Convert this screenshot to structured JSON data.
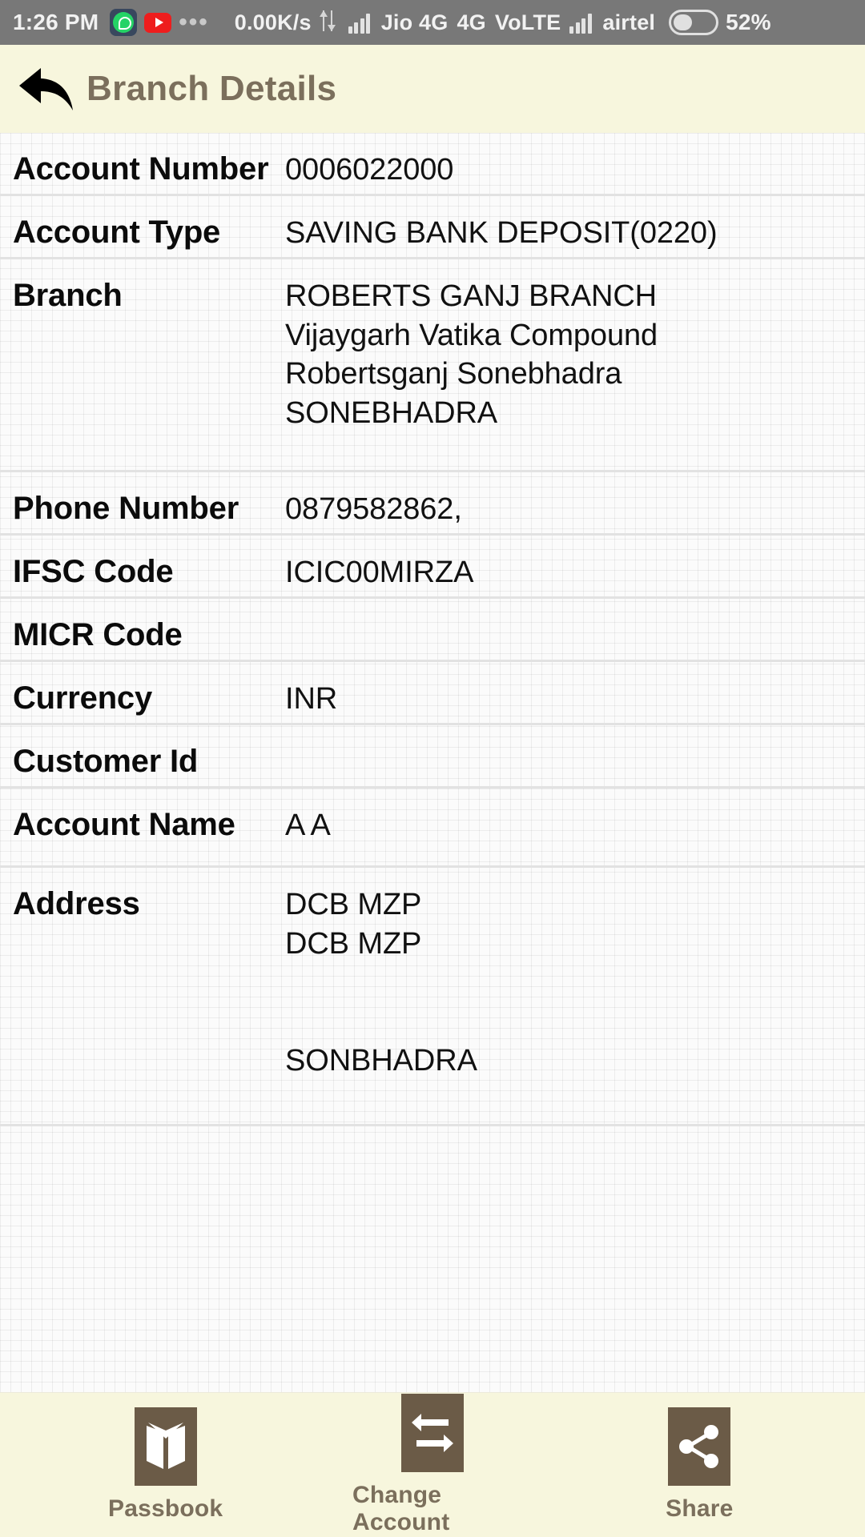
{
  "status_bar": {
    "time": "1:26 PM",
    "icons": [
      "whatsapp-icon",
      "youtube-icon",
      "more-dots-icon"
    ],
    "network_speed": "0.00K/s",
    "data_transfer_icon": "up-down-arrows-icon",
    "sim1_signal_icon": "signal-bars-icon",
    "sim1_carrier": "Jio 4G",
    "network_type": "4G",
    "volte": "VoLTE",
    "sim2_signal_icon": "signal-bars-icon",
    "sim2_carrier": "airtel",
    "battery_icon": "battery-icon",
    "battery_percent": "52%"
  },
  "header": {
    "back_icon": "back-arrow-icon",
    "title": "Branch Details"
  },
  "details": {
    "rows": [
      {
        "label": "Account Number",
        "value": "0006022000"
      },
      {
        "label": "Account Type",
        "value": "SAVING BANK DEPOSIT(0220)"
      },
      {
        "label": "Branch",
        "value": "ROBERTS GANJ BRANCH\nVijaygarh Vatika Compound\nRobertsganj Sonebhadra\nSONEBHADRA"
      },
      {
        "label": "Phone Number",
        "value": "0879582862,"
      },
      {
        "label": "IFSC Code",
        "value": "ICIC00MIRZA"
      },
      {
        "label": "MICR Code",
        "value": ""
      },
      {
        "label": "Currency",
        "value": "INR"
      },
      {
        "label": "Customer Id",
        "value": ""
      },
      {
        "label": "Account Name",
        "value": "A A"
      },
      {
        "label": "Address",
        "value": "DCB MZP\nDCB MZP\n\n\nSONBHADRA"
      }
    ]
  },
  "bottom_bar": {
    "items": [
      {
        "label": "Passbook",
        "icon": "passbook-book-icon"
      },
      {
        "label": "Change Account",
        "icon": "swap-arrows-icon"
      },
      {
        "label": "Share",
        "icon": "share-nodes-icon"
      }
    ]
  },
  "colors": {
    "statusbar_bg": "#787878",
    "header_bg": "#f7f6dd",
    "header_text": "#7b6f5c",
    "content_bg": "#fbfbfb",
    "divider": "#e2e2e2",
    "tile_brown": "#6b5b47"
  }
}
